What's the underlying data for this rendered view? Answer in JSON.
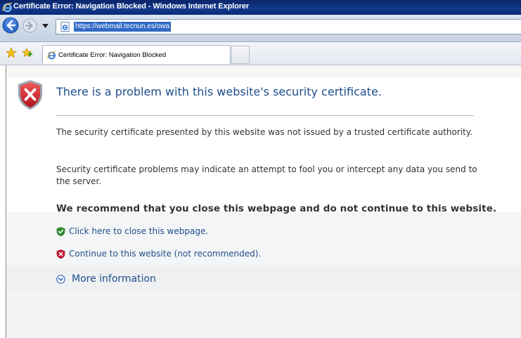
{
  "window": {
    "title": "Certificate Error: Navigation Blocked - Windows Internet Explorer"
  },
  "address_bar": {
    "url": "https://webmail.tecnun.es/owa"
  },
  "tabs": [
    {
      "label": "Certificate Error: Navigation Blocked",
      "active": true
    }
  ],
  "page": {
    "heading": "There is a problem with this website's security certificate.",
    "paragraphs": [
      "The security certificate presented by this website was not issued by a trusted certificate authority.",
      "Security certificate problems may indicate an attempt to fool you or intercept any data you send to the server."
    ],
    "recommendation": "We recommend that you close this webpage and do not continue to this website.",
    "links": {
      "close": "Click here to close this webpage.",
      "continue": "Continue to this website (not recommended)."
    },
    "more_info": "More information"
  },
  "icons": {
    "title": "ie-logo-icon",
    "back": "back-arrow-icon",
    "forward": "forward-arrow-icon",
    "favorites": "favorites-star-icon",
    "add_favorite": "add-favorites-icon",
    "error": "red-shield-x-icon",
    "close_link": "green-shield-check-icon",
    "continue_link": "red-shield-x-icon",
    "more_info": "expand-circle-icon"
  },
  "colors": {
    "title_bar": "#0a246a",
    "link": "#1f4e8c",
    "heading": "#1f4e8c",
    "error_red": "#c8102e",
    "safe_green": "#2f8f2f",
    "url_highlight": "#316ac5"
  }
}
